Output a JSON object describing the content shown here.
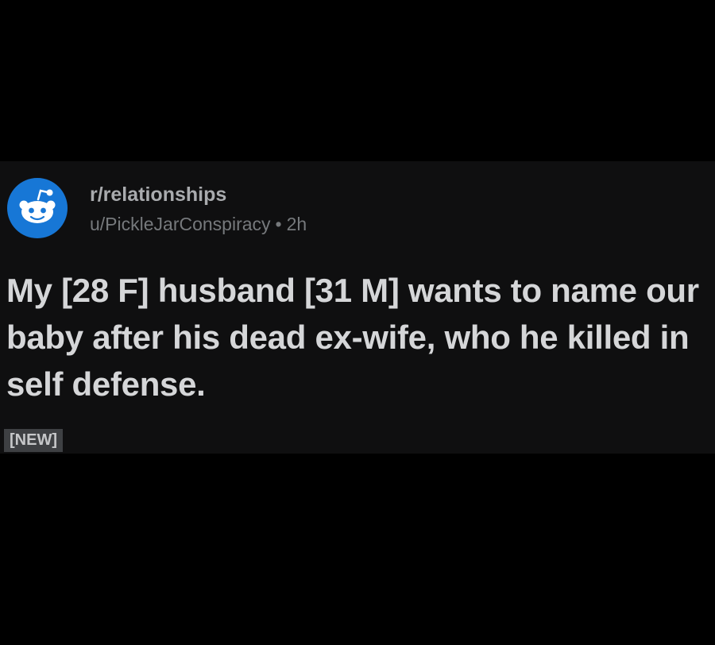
{
  "post": {
    "subreddit": "r/relationships",
    "author": "u/PickleJarConspiracy",
    "separator": "•",
    "age": "2h",
    "title": "My [28 F] husband [31 M] wants to name our baby after his dead ex-wife, who he killed in self defense.",
    "flair": "[NEW]",
    "avatar_icon": "reddit-snoo-icon"
  },
  "colors": {
    "background": "#000000",
    "card": "#0f0f10",
    "avatar_blue": "#1777d6",
    "title_text": "#d5d6d8",
    "meta_text": "#76797c",
    "flair_bg": "#3e4043"
  }
}
